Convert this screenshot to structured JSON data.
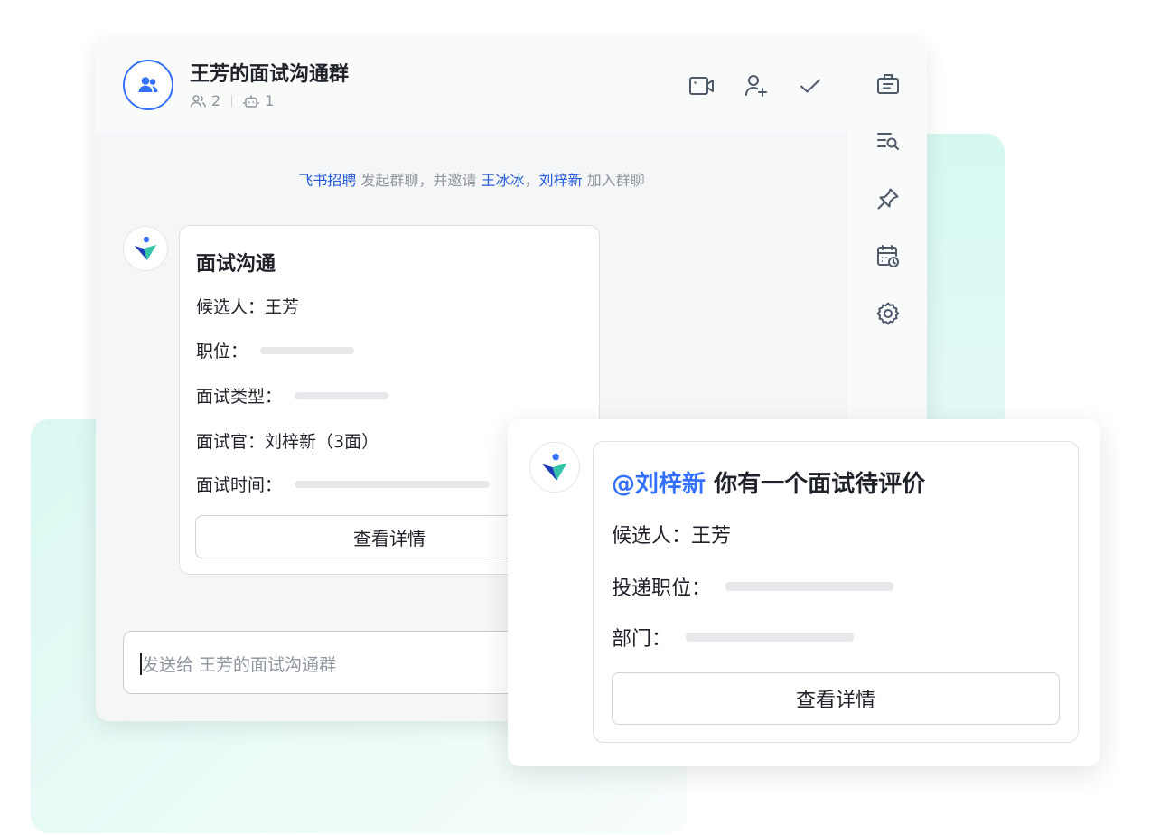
{
  "chat": {
    "title": "王芳的面试沟通群",
    "member_count": "2",
    "bot_count": "1",
    "system_message": {
      "initiator": "飞书招聘",
      "text1": " 发起群聊，并邀请 ",
      "invitee1": "王冰冰",
      "comma": "，",
      "invitee2": "刘梓新",
      "text2": " 加入群聊"
    },
    "input_placeholder": "发送给 王芳的面试沟通群"
  },
  "interview_card": {
    "title": "面试沟通",
    "candidate_label": "候选人：",
    "candidate_value": "王芳",
    "position_label": "职位：",
    "type_label": "面试类型：",
    "interviewer_label": "面试官：",
    "interviewer_value": "刘梓新（3面）",
    "time_label": "面试时间：",
    "detail_button": "查看详情"
  },
  "evaluation_card": {
    "mention": "@刘梓新",
    "title": " 你有一个面试待评价",
    "candidate_label": "候选人：",
    "candidate_value": "王芳",
    "position_label": "投递职位：",
    "department_label": "部门：",
    "detail_button": "查看详情"
  },
  "icons": {
    "header": [
      "video-call-icon",
      "add-member-icon",
      "check-icon"
    ],
    "rail": [
      "briefcase-icon",
      "search-history-icon",
      "pin-icon",
      "calendar-schedule-icon",
      "settings-icon"
    ]
  },
  "colors": {
    "accent": "#3370ff",
    "link": "#245bdb",
    "mint": "#daf7f1"
  }
}
